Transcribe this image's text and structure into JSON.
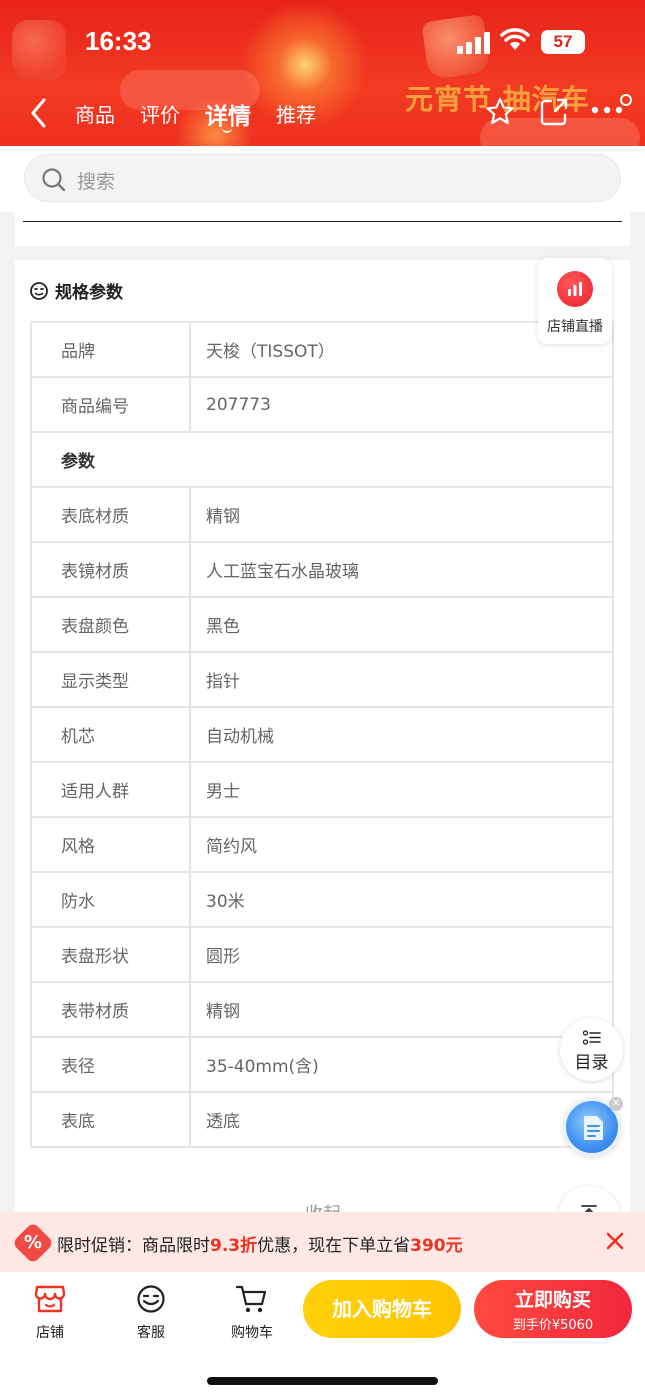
{
  "status_bar": {
    "time": "16:33",
    "battery": "57"
  },
  "header": {
    "tabs": [
      {
        "label": "商品",
        "active": false
      },
      {
        "label": "评价",
        "active": false
      },
      {
        "label": "详情",
        "active": true
      },
      {
        "label": "推荐",
        "active": false
      }
    ],
    "banner_text": "元宵节 抽汽车",
    "icons": [
      "back-icon",
      "star-icon",
      "share-icon",
      "more-icon"
    ]
  },
  "search": {
    "placeholder": "搜索"
  },
  "spec": {
    "title": "规格参数",
    "rows": [
      {
        "key": "品牌",
        "value": "天梭（TISSOT）"
      },
      {
        "key": "商品编号",
        "value": "207773"
      }
    ],
    "section_label": "参数",
    "params": [
      {
        "key": "表底材质",
        "value": "精钢"
      },
      {
        "key": "表镜材质",
        "value": "人工蓝宝石水晶玻璃"
      },
      {
        "key": "表盘颜色",
        "value": "黑色"
      },
      {
        "key": "显示类型",
        "value": "指针"
      },
      {
        "key": "机芯",
        "value": "自动机械"
      },
      {
        "key": "适用人群",
        "value": "男士"
      },
      {
        "key": "风格",
        "value": "简约风"
      },
      {
        "key": "防水",
        "value": "30米"
      },
      {
        "key": "表盘形状",
        "value": "圆形"
      },
      {
        "key": "表带材质",
        "value": "精钢"
      },
      {
        "key": "表径",
        "value": "35-40mm(含)"
      },
      {
        "key": "表底",
        "value": "透底"
      }
    ],
    "collapse_label": "收起"
  },
  "floating": {
    "live_label": "店铺直播",
    "toc_label": "目录"
  },
  "promo": {
    "prefix": "限时促销：商品限时",
    "discount": "9.3折",
    "middle": "优惠，现在下单立省",
    "saving": "390元",
    "colors": {
      "highlight": "#ef3322",
      "bg": "#fde8e6"
    }
  },
  "bottom_bar": {
    "store_label": "店铺",
    "service_label": "客服",
    "cart_label": "购物车",
    "add_cart_label": "加入购物车",
    "buy_label": "立即购买",
    "buy_price": "到手价¥5060"
  }
}
